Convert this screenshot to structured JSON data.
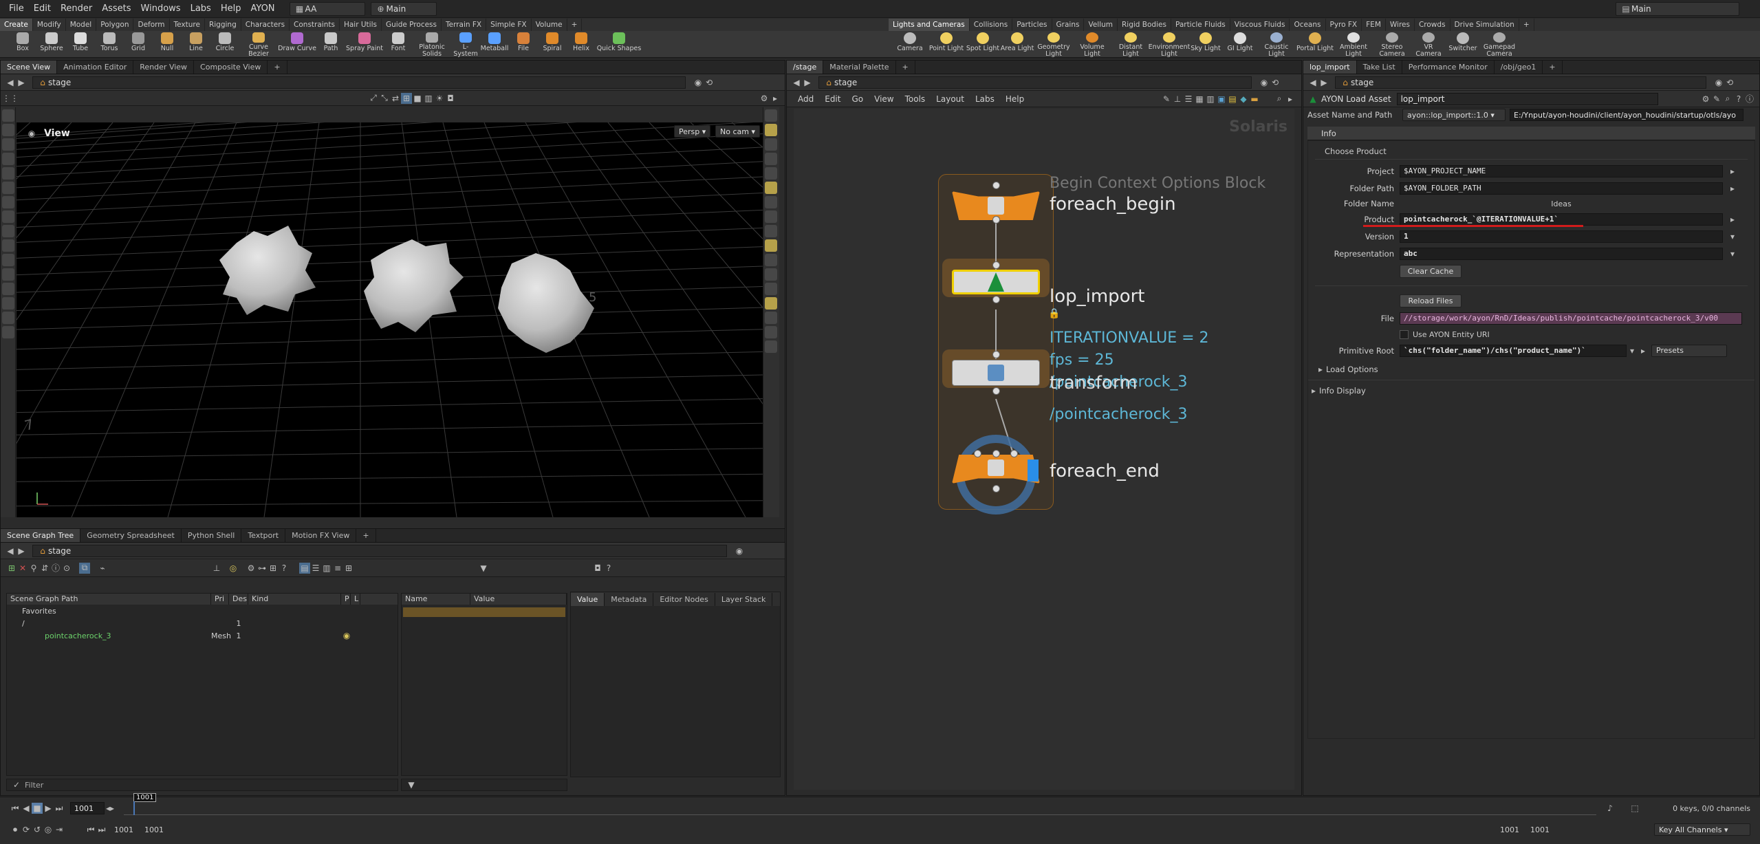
{
  "menubar": {
    "items": [
      "File",
      "Edit",
      "Render",
      "Assets",
      "Windows",
      "Labs",
      "Help",
      "AYON"
    ],
    "desktop": "AA",
    "main_label": "Main",
    "workspace": "Main"
  },
  "shelf_left": {
    "tabs": [
      "Create",
      "Modify",
      "Model",
      "Polygon",
      "Deform",
      "Texture",
      "Rigging",
      "Characters",
      "Constraints",
      "Hair Utils",
      "Guide Process",
      "Terrain FX",
      "Simple FX",
      "Volume"
    ],
    "tools": [
      "Box",
      "Sphere",
      "Tube",
      "Torus",
      "Grid",
      "Null",
      "Line",
      "Circle",
      "Curve Bezier",
      "Draw Curve",
      "Path",
      "Spray Paint",
      "Font",
      "Platonic Solids",
      "L-System",
      "Metaball",
      "File",
      "Spiral",
      "Helix",
      "Quick Shapes"
    ]
  },
  "shelf_right": {
    "tabs": [
      "Lights and Cameras",
      "Collisions",
      "Particles",
      "Grains",
      "Vellum",
      "Rigid Bodies",
      "Particle Fluids",
      "Viscous Fluids",
      "Oceans",
      "Pyro FX",
      "FEM",
      "Wires",
      "Crowds",
      "Drive Simulation"
    ],
    "tools": [
      "Camera",
      "Point Light",
      "Spot Light",
      "Area Light",
      "Geometry Light",
      "Volume Light",
      "Distant Light",
      "Environment Light",
      "Sky Light",
      "GI Light",
      "Caustic Light",
      "Portal Light",
      "Ambient Light",
      "Stereo Camera",
      "VR Camera",
      "Switcher",
      "Gamepad Camera"
    ]
  },
  "scene_pane": {
    "tabs": [
      "Scene View",
      "Animation Editor",
      "Render View",
      "Composite View"
    ],
    "path": "stage",
    "view_label": "View",
    "persp": "Persp",
    "cam": "No cam",
    "grid_labels": [
      "5",
      "7"
    ]
  },
  "spread_pane": {
    "tabs": [
      "Scene Graph Tree",
      "Geometry Spreadsheet",
      "Python Shell",
      "Textport",
      "Motion FX View"
    ],
    "path": "stage",
    "columns": [
      "Scene Graph Path",
      "Pri",
      "Des",
      "Kind",
      "P",
      "L"
    ],
    "rows": [
      {
        "name": "Favorites",
        "pri": "",
        "des": "",
        "kind": ""
      },
      {
        "name": "/",
        "pri": "",
        "des": "1",
        "kind": ""
      },
      {
        "name": "pointcacherock_3",
        "pri": "Mesh",
        "des": "1",
        "kind": ""
      }
    ],
    "attr_cols": [
      "Name",
      "Value"
    ],
    "value_tabs": [
      "Value",
      "Metadata",
      "Editor Nodes",
      "Layer Stack"
    ],
    "filter": "Filter"
  },
  "network_pane": {
    "tabs": [
      "/stage",
      "Material Palette"
    ],
    "path": "stage",
    "menu": [
      "Add",
      "Edit",
      "Go",
      "View",
      "Tools",
      "Layout",
      "Labs",
      "Help"
    ],
    "context": "Solaris",
    "block_label": "Begin Context Options Block",
    "nodes": [
      "foreach_begin",
      "lop_import",
      "transform",
      "foreach_end"
    ],
    "info_lines": [
      "ITERATIONVALUE = 2",
      "fps = 25",
      "/pointcacherock_3",
      "/pointcacherock_3"
    ]
  },
  "param_pane": {
    "tabs": [
      "lop_import",
      "Take List",
      "Performance Monitor",
      "/obj/geo1"
    ],
    "path": "stage",
    "node_type": "AYON Load Asset",
    "node_name": "lop_import",
    "asset_label": "Asset Name and Path",
    "asset_value": "ayon::lop_import::1.0",
    "asset_path": "E:/Ynput/ayon-houdini/client/ayon_houdini/startup/otls/ayo",
    "info_tab": "Info",
    "section": "Choose Product",
    "project_label": "Project",
    "project": "$AYON_PROJECT_NAME",
    "folder_label": "Folder Path",
    "folder": "$AYON_FOLDER_PATH",
    "folder_name_label": "Folder Name",
    "folder_name": "Ideas",
    "product_label": "Product",
    "product": "pointcacherock_`@ITERATIONVALUE+1`",
    "version_label": "Version",
    "version": "1",
    "rep_label": "Representation",
    "representation": "abc",
    "clear_cache": "Clear Cache",
    "reload": "Reload Files",
    "file_label": "File",
    "file": "//storage/work/ayon/RnD/Ideas/publish/pointcache/pointcacherock_3/v00",
    "use_uri": "Use AYON Entity URI",
    "prim_label": "Primitive Root",
    "prim": "`chs(\"folder_name\")/chs(\"product_name\")`",
    "presets": "Presets",
    "load_options": "Load Options",
    "info_display": "Info Display"
  },
  "timeline": {
    "frame": "1001",
    "frame_box": "1001",
    "start": "1001",
    "end": "1001",
    "range_start": "1001",
    "range_end": "1001",
    "keys": "0 keys, 0/0 channels",
    "key_all": "Key All Channels"
  },
  "colors": {
    "accent_orange": "#e8891e",
    "network_bg": "#2f2f2f",
    "red_underline": "#d21b1b",
    "info_cyan": "#5db7d6"
  }
}
